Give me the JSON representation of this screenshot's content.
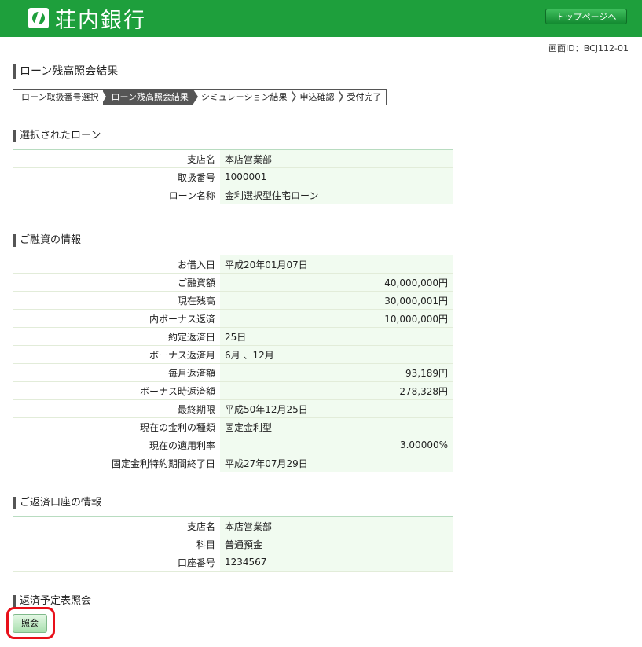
{
  "header": {
    "bank_name": "荘内銀行",
    "top_button_label": "トップページへ",
    "brand_color": "#1e9f3c"
  },
  "screen_id": "画面ID：BCJ112-01",
  "page_title": "ローン残高照会結果",
  "steps": [
    {
      "label": "ローン取扱番号選択",
      "active": false
    },
    {
      "label": "ローン残高照会結果",
      "active": true
    },
    {
      "label": "シミュレーション結果",
      "active": false
    },
    {
      "label": "申込確認",
      "active": false
    },
    {
      "label": "受付完了",
      "active": false
    }
  ],
  "selected_loan": {
    "title": "選択されたローン",
    "rows": [
      {
        "label": "支店名",
        "value": "本店営業部"
      },
      {
        "label": "取扱番号",
        "value": "1000001"
      },
      {
        "label": "ローン名称",
        "value": "金利選択型住宅ローン"
      }
    ]
  },
  "financing": {
    "title": "ご融資の情報",
    "rows": [
      {
        "label": "お借入日",
        "value": "平成20年01月07日"
      },
      {
        "label": "ご融資額",
        "value": "40,000,000円"
      },
      {
        "label": "現在残高",
        "value": "30,000,001円"
      },
      {
        "label": "内ボーナス返済",
        "value": "10,000,000円"
      },
      {
        "label": "約定返済日",
        "value": "25日"
      },
      {
        "label": "ボーナス返済月",
        "value": "6月 、12月"
      },
      {
        "label": "毎月返済額",
        "value": "93,189円"
      },
      {
        "label": "ボーナス時返済額",
        "value": "278,328円"
      },
      {
        "label": "最終期限",
        "value": "平成50年12月25日"
      },
      {
        "label": "現在の金利の種類",
        "value": "固定金利型"
      },
      {
        "label": "現在の適用利率",
        "value": "3.00000%"
      },
      {
        "label": "固定金利特約期間終了日",
        "value": "平成27年07月29日"
      }
    ]
  },
  "repayment_account": {
    "title": "ご返済口座の情報",
    "rows": [
      {
        "label": "支店名",
        "value": "本店営業部"
      },
      {
        "label": "科目",
        "value": "普通預金"
      },
      {
        "label": "口座番号",
        "value": "1234567"
      }
    ]
  },
  "schedule": {
    "title": "返済予定表照会",
    "button_label": "照会"
  }
}
